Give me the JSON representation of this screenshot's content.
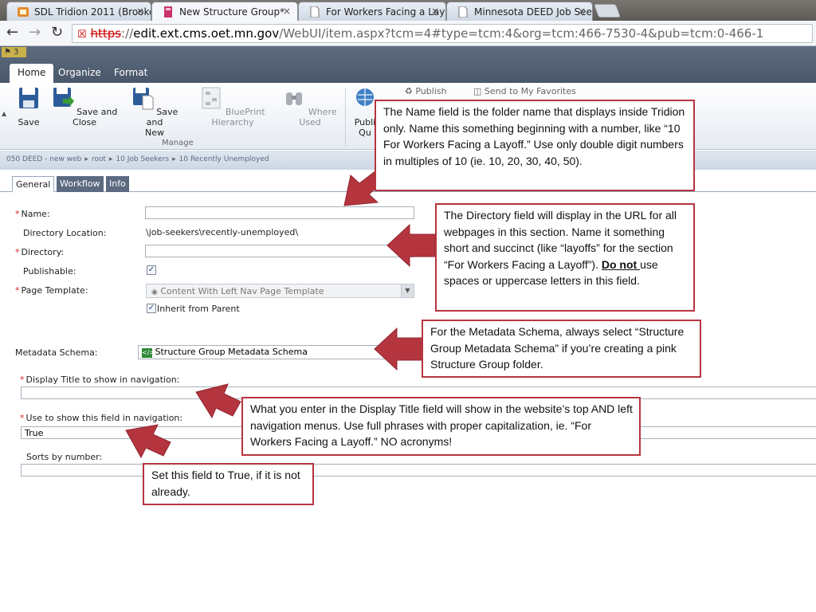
{
  "browser": {
    "tabs": [
      {
        "title": "SDL Tridion 2011 (Brooke F",
        "close": "×"
      },
      {
        "title": "New Structure Group*",
        "close": "×"
      },
      {
        "title": "For Workers Facing a Layo",
        "close": "×"
      },
      {
        "title": "Minnesota DEED Job Seek",
        "close": "×"
      }
    ],
    "url": {
      "scheme": "https",
      "sep": "://",
      "host": "edit.ext.cms.oet.mn.gov",
      "path": "/WebUI/item.aspx?tcm=4#type=tcm:4&org=tcm:466-7530-4&pub=tcm:0-466-1"
    }
  },
  "cms": {
    "badge": "3",
    "ribbon_tabs": [
      "Home",
      "Organize",
      "Format"
    ],
    "ribbon_buttons": {
      "save": "Save",
      "save_close": "Save and Close",
      "save_new_1": "Save and",
      "save_new_2": "New",
      "blueprint": "BluePrint Hierarchy",
      "where_used": "Where Used",
      "publish_1": "Publi",
      "publish_2": "Qu"
    },
    "group_label": "Manage",
    "small_buttons": {
      "publish": "Publish",
      "favorites": "Send to My Favorites"
    },
    "breadcrumb": [
      "050 DEED - new web",
      "root",
      "10 Job Seekers",
      "10 Recently Unemployed"
    ],
    "breadcrumb_sep": "▸",
    "inner_tabs": [
      "General",
      "Workflow",
      "Info"
    ],
    "form": {
      "name_label": "Name:",
      "dir_location_label": "Directory Location:",
      "dir_location_value": "\\job-seekers\\recently-unemployed\\",
      "directory_label": "Directory:",
      "publishable_label": "Publishable:",
      "page_template_label": "Page Template:",
      "page_template_value": "Content With Left Nav Page Template",
      "inherit_label": "Inherit from Parent",
      "metadata_label": "Metadata Schema:",
      "metadata_value": "Structure Group Metadata Schema",
      "display_title_label": "Display Title to show in navigation:",
      "use_show_label": "Use to show this field in navigation:",
      "use_show_value": "True",
      "sorts_label": "Sorts by number:",
      "required_mark": "*",
      "check_mark": "✓"
    }
  },
  "callouts": {
    "name": "The Name field is the folder name that displays inside Tridion only. Name this something beginning with a number, like “10 For Workers Facing a Layoff.” Use only double digit numbers in multiples of 10 (ie. 10, 20, 30, 40, 50).",
    "directory_before": "The Directory field will display in the URL for all webpages in this section. Name it something short and succinct (like “layoffs” for the section “For Workers Facing a Layoff”). ",
    "directory_emph": "Do not ",
    "directory_after": "use spaces or uppercase letters in this field.",
    "metadata": "For the Metadata Schema, always select “Structure Group Metadata Schema” if you’re creating a pink Structure Group folder.",
    "display_title": "What you enter in the Display Title field will show in the website’s top AND left navigation menus. Use full phrases with proper capitalization, ie. “For Workers Facing a Layoff.” NO acronyms!",
    "true_field": "Set this field to True, if it is not already."
  },
  "colors": {
    "callout_border": "#b5353f",
    "arrow_fill": "#b5353f",
    "cms_band": "#52607a",
    "required": "#d22222"
  }
}
